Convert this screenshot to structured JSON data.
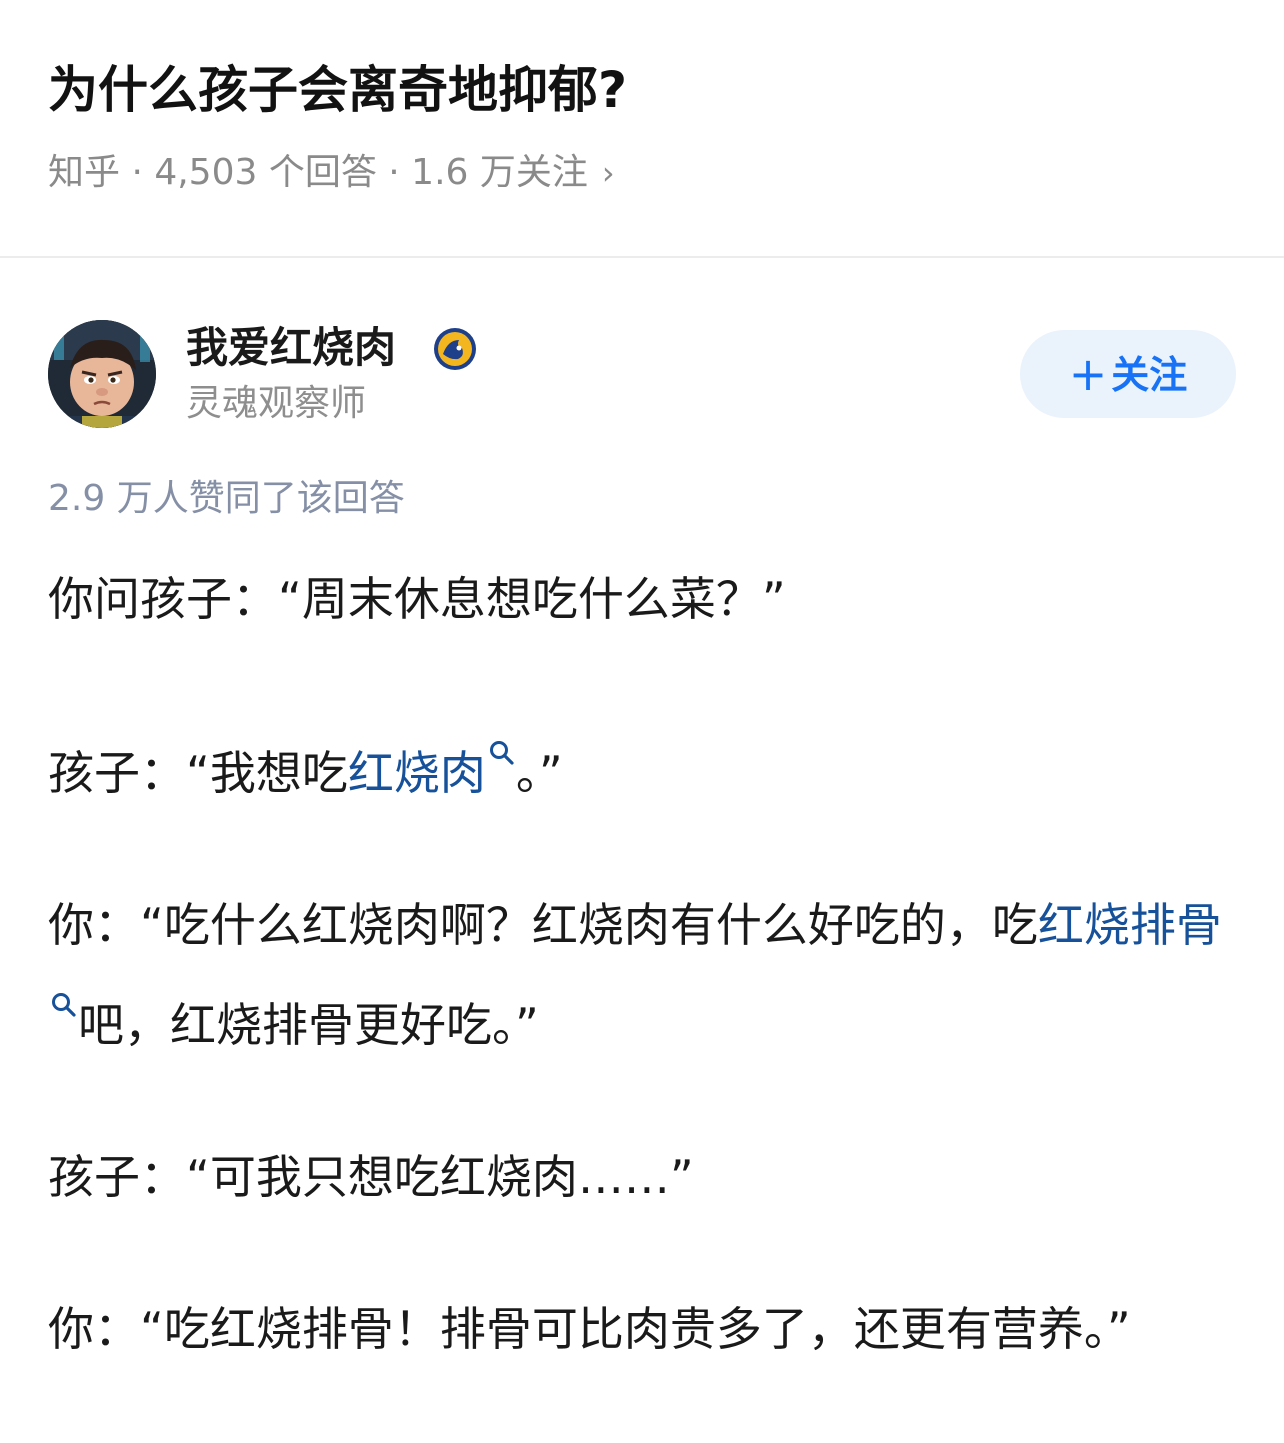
{
  "question": {
    "title": "为什么孩子会离奇地抑郁?",
    "meta": "知乎 · 4,503 个回答 · 1.6 万关注",
    "arrow": "›"
  },
  "author": {
    "name": "我爱红烧肉",
    "bio": "灵魂观察师",
    "follow_label": "关注",
    "follow_plus": "+"
  },
  "answer": {
    "upvotes": "2.9 万人赞同了该回答",
    "p1": "你问孩子：“周末休息想吃什么菜？”",
    "p2_a": "孩子：“我想吃",
    "p2_link": "红烧肉",
    "p2_b": "。”",
    "p3_a": "你：“吃什么红烧肉啊？红烧肉有什么好吃的，吃",
    "p3_link": "红烧排骨",
    "p3_b": "吧，红烧排骨更好吃。”",
    "p4": "孩子：“可我只想吃红烧肉……”",
    "p5": "你：“吃红烧排骨！排骨可比肉贵多了，还更有营养。”"
  },
  "colors": {
    "link": "#175199",
    "follow_text": "#1772f6",
    "follow_bg": "#eaf2fc",
    "meta_gray": "#8a8a8a"
  }
}
